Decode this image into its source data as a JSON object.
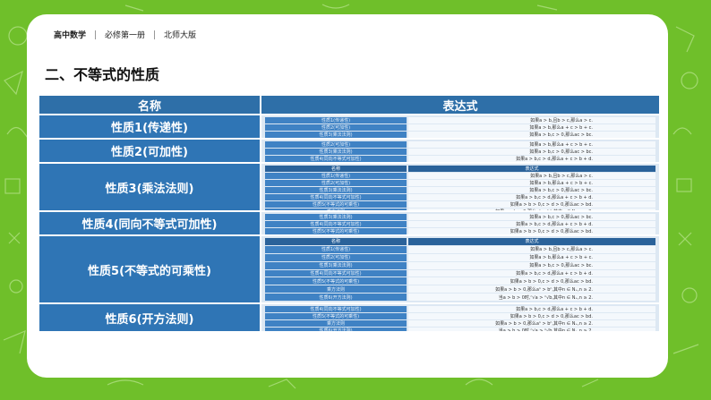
{
  "header": {
    "subject": "高中数学",
    "book": "必修第一册",
    "publisher": "北师大版"
  },
  "section_title": "二、不等式的性质",
  "table": {
    "col_name": "名称",
    "col_expr": "表达式",
    "rows": [
      "性质1(传递性)",
      "性质2(可加性)",
      "性质3(乘法法则)",
      "性质4(同向不等式可加性)",
      "性质5(不等式的可乘性)",
      "性质6(开方法则)"
    ]
  },
  "mini_table": {
    "head_left": "名称",
    "head_right": "表达式",
    "items": [
      {
        "name": "性质1(传递性)",
        "expr": "如果a > b,且b > c,那么a > c."
      },
      {
        "name": "性质2(可加性)",
        "expr": "如果a > b,那么a + c > b + c."
      },
      {
        "name": "性质3(乘法法则)",
        "expr": "如果a > b,c > 0,那么ac > bc."
      },
      {
        "name": "性质4(同向不等式可加性)",
        "expr": "如果a > b,c > d,那么a + c > b + d."
      },
      {
        "name": "性质5(不等式的可乘性)",
        "expr": "如果a > b > 0,c > d > 0,那么ac > bd."
      },
      {
        "name": "乘方法则",
        "expr": "如果a > b > 0,那么aⁿ > bⁿ,其中n ∈ N₊,n ≥ 2."
      },
      {
        "name": "性质6(开方法则)",
        "expr": "当a > b > 0时,ⁿ√a > ⁿ√b,其中n ∈ N₊,n ≥ 2."
      }
    ]
  }
}
